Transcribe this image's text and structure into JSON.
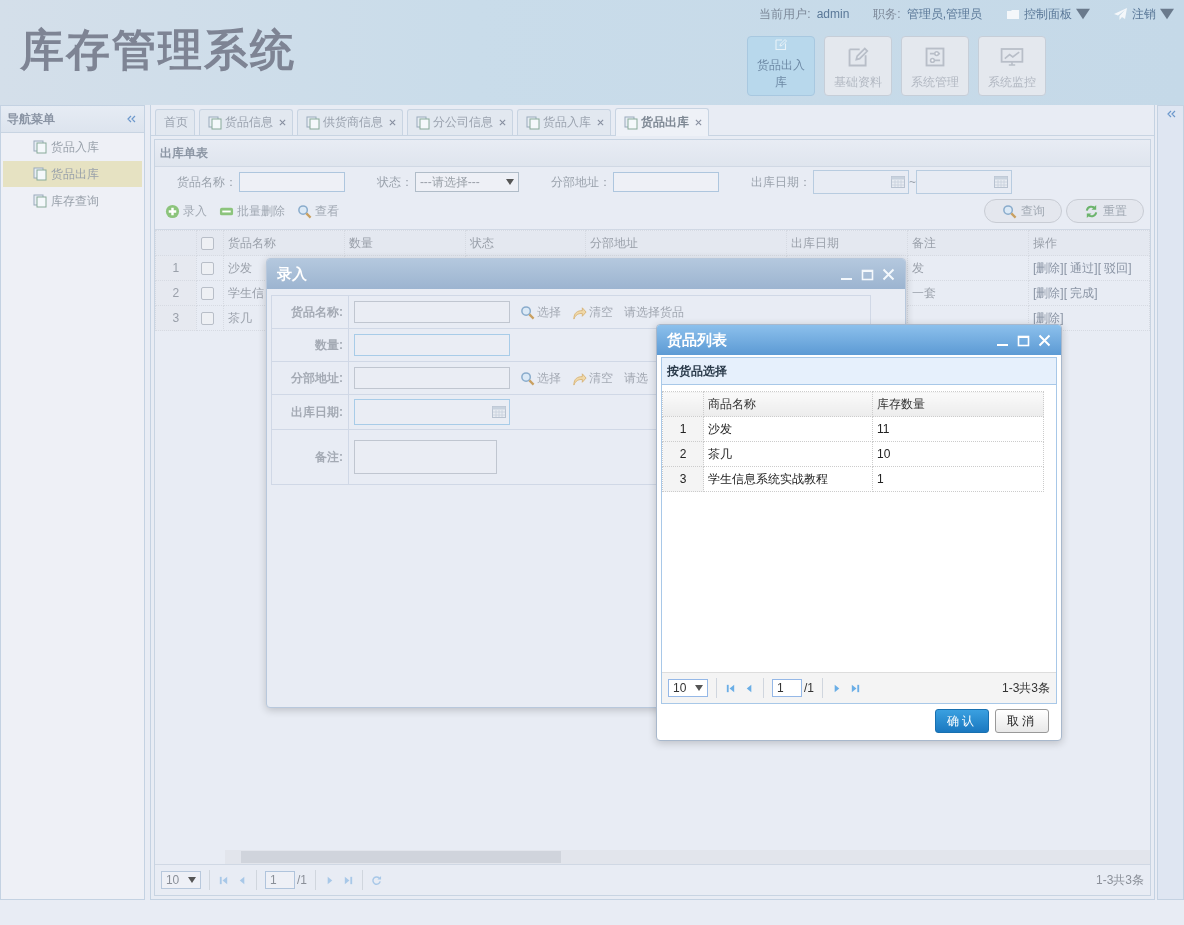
{
  "app_title": "库存管理系统",
  "user_bar": {
    "user_label": "当前用户:",
    "user": "admin",
    "role_label": "职务:",
    "role": "管理员,管理员",
    "control_panel": "控制面板",
    "logout": "注销"
  },
  "modules": [
    {
      "label": "货品出入库",
      "kind": "edit",
      "selected": true
    },
    {
      "label": "基础资料",
      "kind": "edit",
      "selected": false
    },
    {
      "label": "系统管理",
      "kind": "settings",
      "selected": false
    },
    {
      "label": "系统监控",
      "kind": "monitor",
      "selected": false
    }
  ],
  "sidebar": {
    "title": "导航菜单",
    "items": [
      {
        "label": "货品入库",
        "selected": false
      },
      {
        "label": "货品出库",
        "selected": true
      },
      {
        "label": "库存查询",
        "selected": false
      }
    ]
  },
  "tabs": [
    {
      "label": "首页",
      "closable": false,
      "selected": false
    },
    {
      "label": "货品信息",
      "closable": true,
      "selected": false
    },
    {
      "label": "供货商信息",
      "closable": true,
      "selected": false
    },
    {
      "label": "分公司信息",
      "closable": true,
      "selected": false
    },
    {
      "label": "货品入库",
      "closable": true,
      "selected": false
    },
    {
      "label": "货品出库",
      "closable": true,
      "selected": true
    }
  ],
  "panel": {
    "title": "出库单表",
    "filters": [
      {
        "label": "货品名称：",
        "kind": "text"
      },
      {
        "label": "状态：",
        "kind": "select",
        "value": "---请选择---"
      },
      {
        "label": "分部地址：",
        "kind": "text"
      },
      {
        "label": "出库日期：",
        "kind": "daterange",
        "separator": "~"
      }
    ],
    "toolbar": [
      {
        "label": "录入",
        "kind": "add"
      },
      {
        "label": "批量删除",
        "kind": "remove"
      },
      {
        "label": "查看",
        "kind": "search"
      }
    ],
    "actions": [
      {
        "label": "查询",
        "kind": "search"
      },
      {
        "label": "重置",
        "kind": "reset"
      }
    ],
    "table": {
      "columns": [
        "货品名称",
        "数量",
        "状态",
        "分部地址",
        "出库日期",
        "备注",
        "操作"
      ],
      "all_checked": false,
      "rows": [
        {
          "index": "1",
          "checked": false,
          "name": "沙发",
          "remark": "发",
          "ops": [
            "[删除]",
            "[ 通过]",
            "[ 驳回]"
          ]
        },
        {
          "index": "2",
          "checked": false,
          "name": "学生信",
          "remark": "一套",
          "ops": [
            "[删除]",
            "[ 完成]"
          ]
        },
        {
          "index": "3",
          "checked": false,
          "name": "茶几",
          "ops": [
            "[删除]"
          ]
        }
      ]
    },
    "pager": {
      "page_size": "10",
      "page": "1",
      "total_pages": "/1",
      "summary": "1-3共3条"
    }
  },
  "entry_dialog": {
    "title": "录入",
    "fields": [
      {
        "label": "货品名称:",
        "kind": "picker",
        "pick": "选择",
        "clear": "清空",
        "hint": "请选择货品"
      },
      {
        "label": "数量:",
        "kind": "text"
      },
      {
        "label": "分部地址:",
        "kind": "picker",
        "pick": "选择",
        "clear": "清空",
        "hint": "请选"
      },
      {
        "label": "出库日期:",
        "kind": "date"
      },
      {
        "label": "备注:",
        "kind": "textarea"
      }
    ]
  },
  "goods_dialog": {
    "title": "货品列表",
    "section": "按货品选择",
    "columns": [
      "商品名称",
      "库存数量"
    ],
    "rows": [
      {
        "index": "1",
        "name": "沙发",
        "stock": "11"
      },
      {
        "index": "2",
        "name": "茶几",
        "stock": "10"
      },
      {
        "index": "3",
        "name": "学生信息系统实战教程",
        "stock": "1"
      }
    ],
    "pager": {
      "page_size": "10",
      "page": "1",
      "total_pages": "/1",
      "summary": "1-3共3条"
    },
    "buttons": [
      {
        "label": "确认",
        "kind": "primary"
      },
      {
        "label": "取消",
        "kind": "default"
      }
    ]
  }
}
